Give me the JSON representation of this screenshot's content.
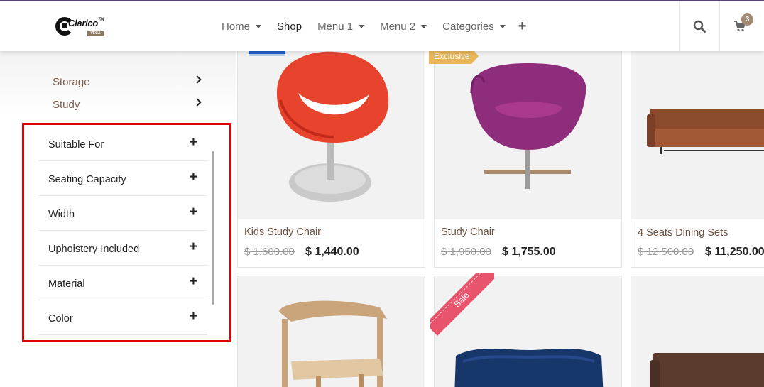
{
  "brand": {
    "name": "Clarico",
    "tm": "TM",
    "tag": "VEGA"
  },
  "nav": {
    "items": [
      {
        "label": "Home",
        "dropdown": true
      },
      {
        "label": "Shop",
        "dropdown": false,
        "active": true
      },
      {
        "label": "Menu 1",
        "dropdown": true
      },
      {
        "label": "Menu 2",
        "dropdown": true
      },
      {
        "label": "Categories",
        "dropdown": true
      }
    ],
    "more_icon": "plus-icon",
    "search_icon": "search-icon",
    "cart_icon": "cart-icon",
    "cart_count": "3"
  },
  "sidebar": {
    "categories": [
      {
        "label": "Storage"
      },
      {
        "label": "Study"
      }
    ],
    "filters": [
      {
        "label": "Suitable For"
      },
      {
        "label": "Seating Capacity"
      },
      {
        "label": "Width"
      },
      {
        "label": "Upholstery Included"
      },
      {
        "label": "Material"
      },
      {
        "label": "Color"
      }
    ],
    "highlight_color": "#e00000"
  },
  "products": [
    {
      "name": "Kids Study Chair",
      "old_price": "$ 1,600.00",
      "price": "$ 1,440.00",
      "badge": "",
      "image": "red-chair"
    },
    {
      "name": "Study Chair",
      "old_price": "$ 1,950.00",
      "price": "$ 1,755.00",
      "badge": "Exclusive",
      "image": "purple-chair"
    },
    {
      "name": "4 Seats Dining Sets",
      "old_price": "$ 12,500.00",
      "price": "$ 11,250.00",
      "badge": "",
      "image": "brown-sofa"
    },
    {
      "name": "",
      "image": "wooden-chair"
    },
    {
      "name": "",
      "badge": "Sale",
      "image": "blue-sofa"
    },
    {
      "name": "",
      "image": "dark-brown-sofa"
    }
  ],
  "colors": {
    "accent": "#7a5a48",
    "exclusive": "#e9b65a",
    "sale": "#e8546b",
    "badge": "#a58a72"
  }
}
